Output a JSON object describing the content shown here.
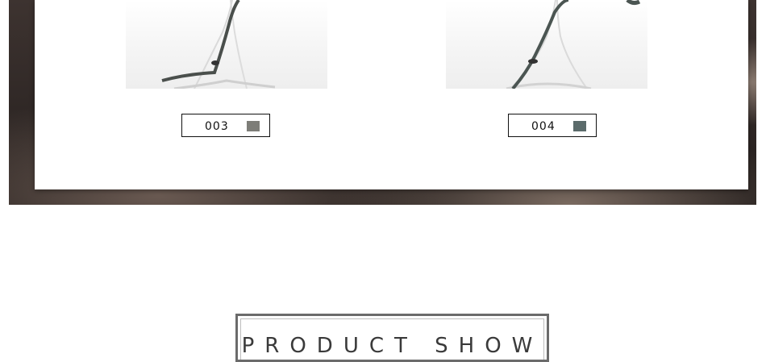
{
  "products": [
    {
      "code": "003",
      "swatch_color": "#7d7d78"
    },
    {
      "code": "004",
      "swatch_color": "#5b6b6b"
    }
  ],
  "section": {
    "title": "PRODUCT SHOW"
  },
  "colors": {
    "frame": "#6b6b6b",
    "tag_border": "#111111"
  }
}
